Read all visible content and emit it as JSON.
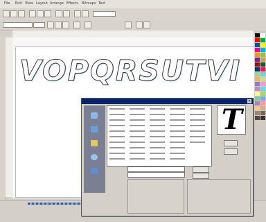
{
  "menu": {
    "items": [
      "File",
      "Edit",
      "View",
      "Layout",
      "Arrange",
      "Effects",
      "Bitmaps",
      "Text",
      "Tools",
      "Window",
      "Help"
    ]
  },
  "canvas": {
    "text": "VOPQRSUTVI"
  },
  "dialog": {
    "preview_glyph": "T",
    "ok_label": "",
    "cancel_label": "",
    "font_label": "",
    "style_label": "",
    "sample_label": "",
    "options_label": ""
  },
  "palette": {
    "colors": [
      "#000000",
      "#ffffff",
      "#ff0000",
      "#00a651",
      "#0054a6",
      "#fff200",
      "#ec008c",
      "#00aeef",
      "#f7941d",
      "#8dc63f",
      "#662d91",
      "#c69c6d",
      "#9e0b0f",
      "#005e20",
      "#003471",
      "#ed145b",
      "#a3d39c",
      "#7accc8",
      "#fbaf5d",
      "#c4df9b",
      "#8781bd",
      "#f49ac2",
      "#bd8cbf",
      "#6dcff6",
      "#fff799",
      "#acd373",
      "#82ca9c",
      "#7da7d9",
      "#a186be",
      "#f6989d",
      "#fdc68a",
      "#c7b299",
      "#998675",
      "#736357",
      "#534741",
      "#362f2d"
    ]
  }
}
